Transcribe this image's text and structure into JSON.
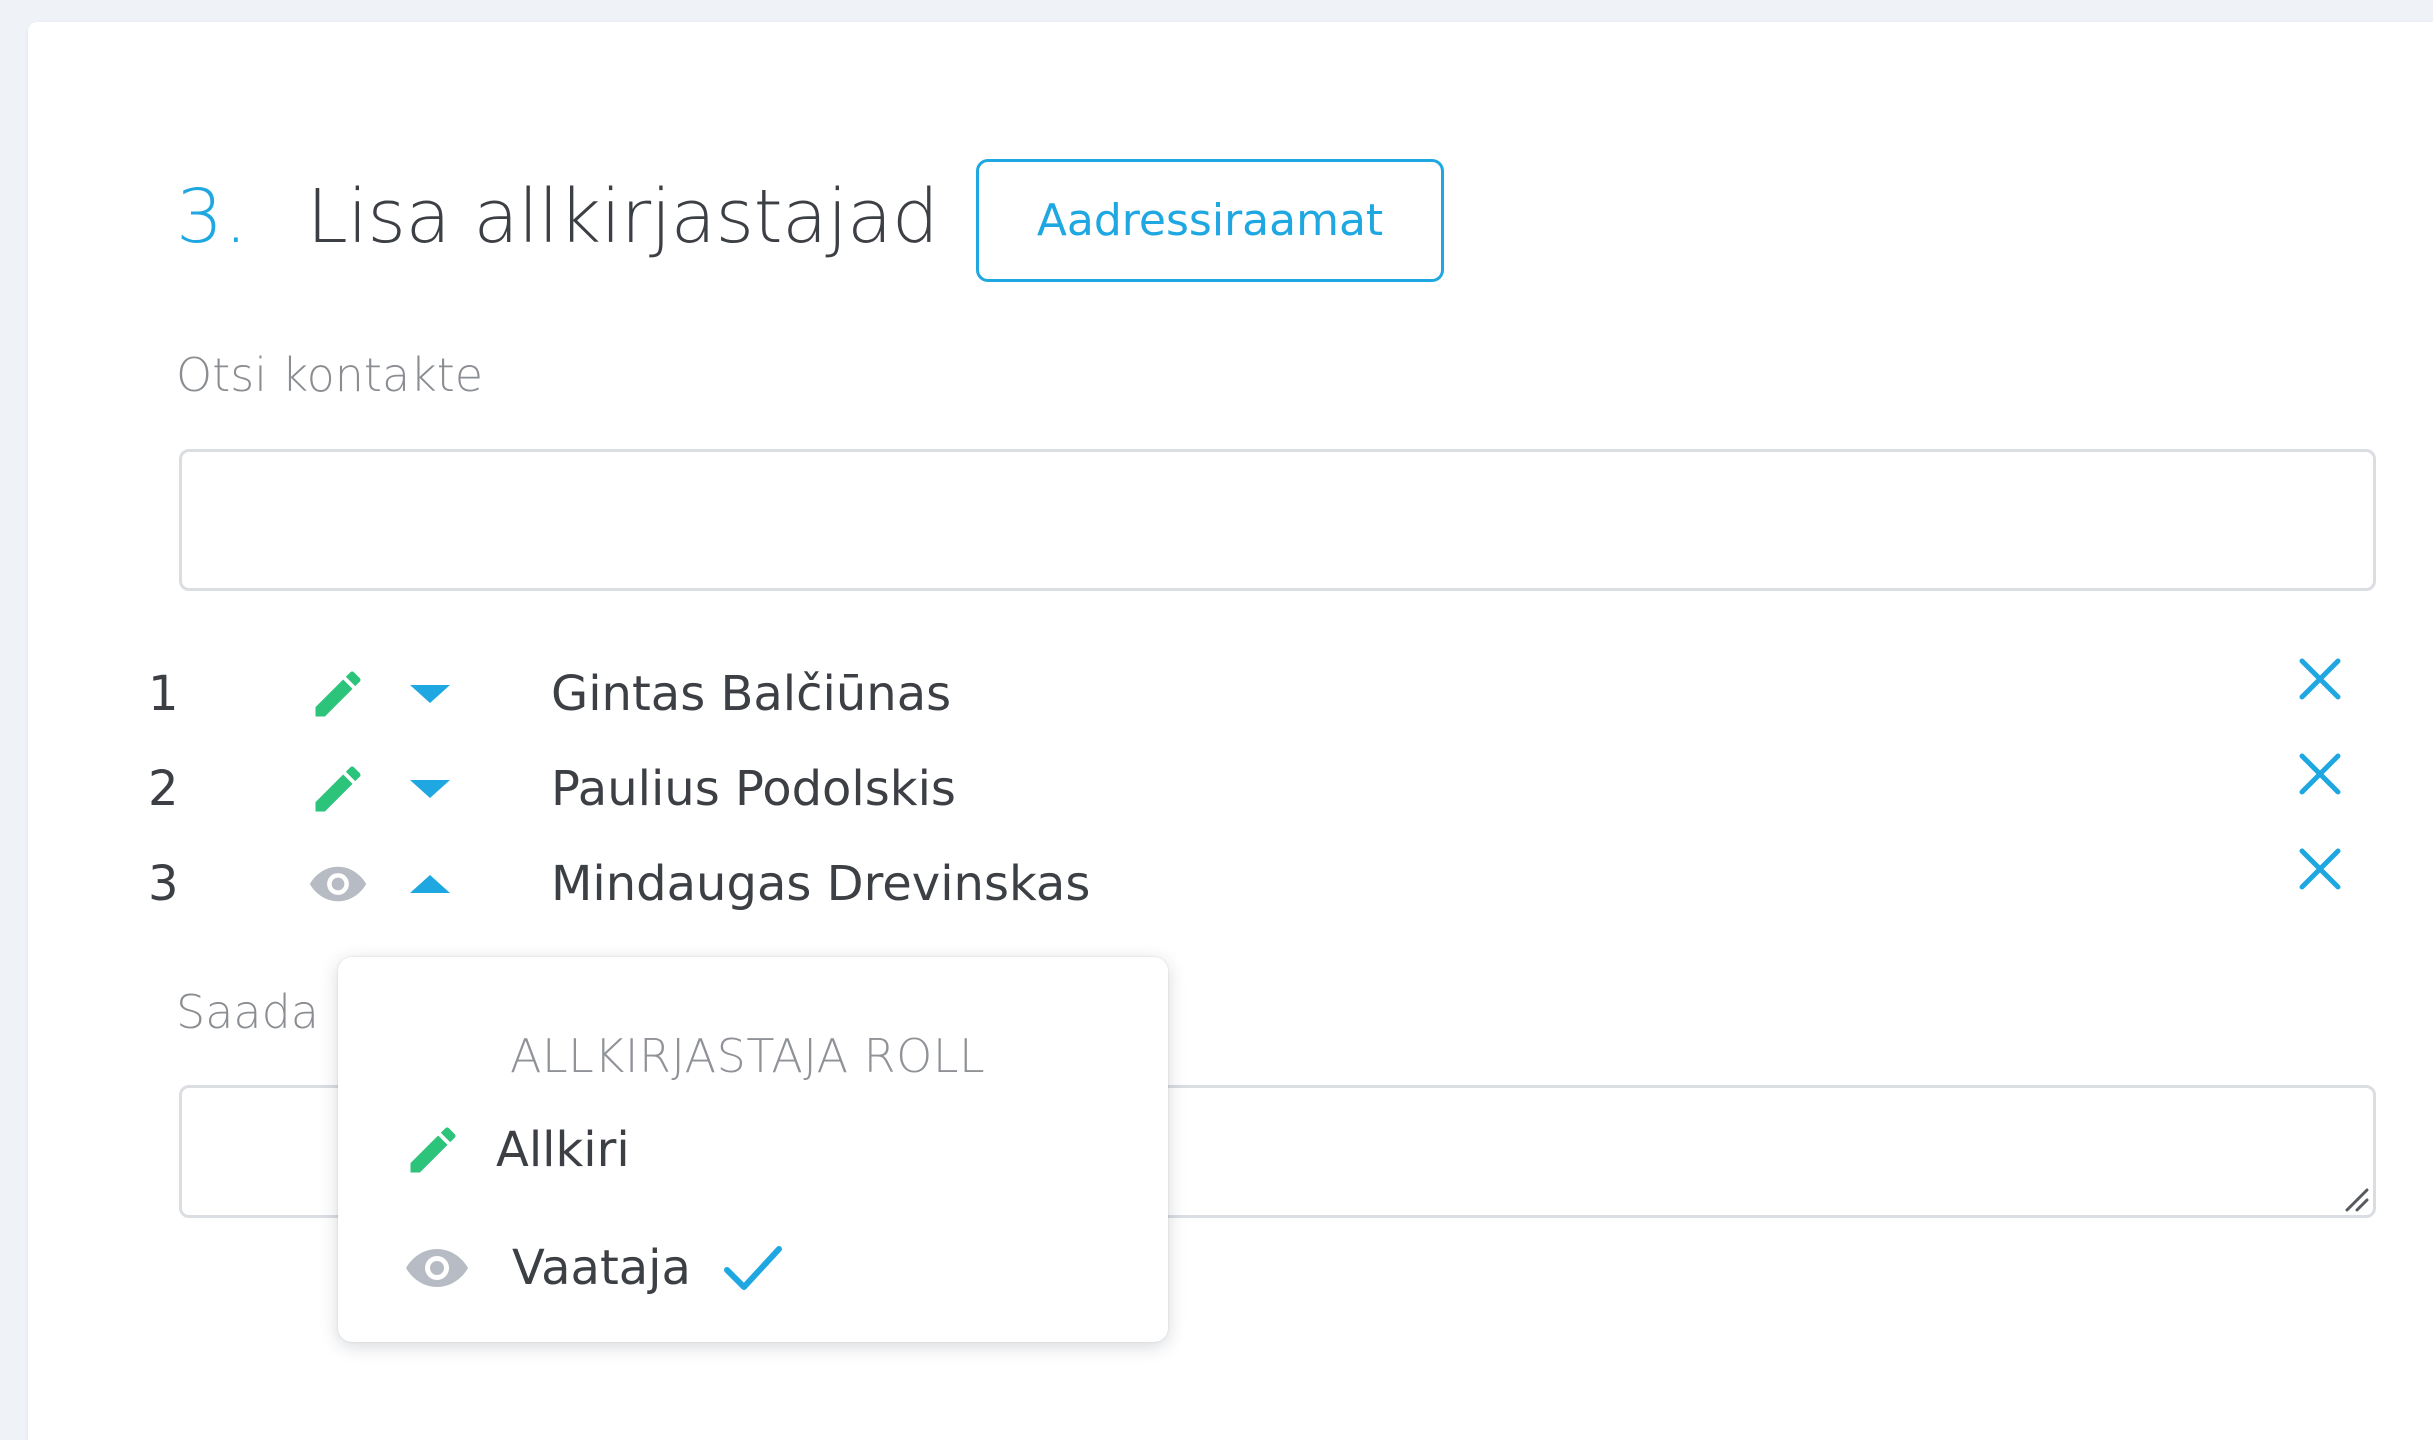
{
  "colors": {
    "accent": "#1ea7e1",
    "pencil_green": "#2cc37a",
    "eye_gray": "#b7bbc3",
    "text": "#3c3f44",
    "muted": "#8a8d91",
    "border": "#dadde2",
    "background": "#eff2f7"
  },
  "section": {
    "step_number": "3.",
    "title": "Lisa allkirjastajad",
    "address_book_button": "Aadressiraamat"
  },
  "search": {
    "label": "Otsi kontakte",
    "value": "",
    "placeholder": ""
  },
  "signers": [
    {
      "index": "1",
      "name": "Gintas Balčiūnas",
      "role_icon": "pencil-icon",
      "toggle_icon": "caret-down-icon",
      "remove_icon": "close-icon"
    },
    {
      "index": "2",
      "name": "Paulius Podolskis",
      "role_icon": "pencil-icon",
      "toggle_icon": "caret-down-icon",
      "remove_icon": "close-icon"
    },
    {
      "index": "3",
      "name": "Mindaugas Drevinskas",
      "role_icon": "eye-icon",
      "toggle_icon": "caret-up-icon",
      "remove_icon": "close-icon"
    }
  ],
  "message": {
    "label": "Saada",
    "value": ""
  },
  "role_popover": {
    "heading": "ALLKIRJASTAJA ROLL",
    "options": [
      {
        "label": "Allkiri",
        "icon": "pencil-icon",
        "selected": false
      },
      {
        "label": "Vaataja",
        "icon": "eye-icon",
        "selected": true
      }
    ]
  }
}
